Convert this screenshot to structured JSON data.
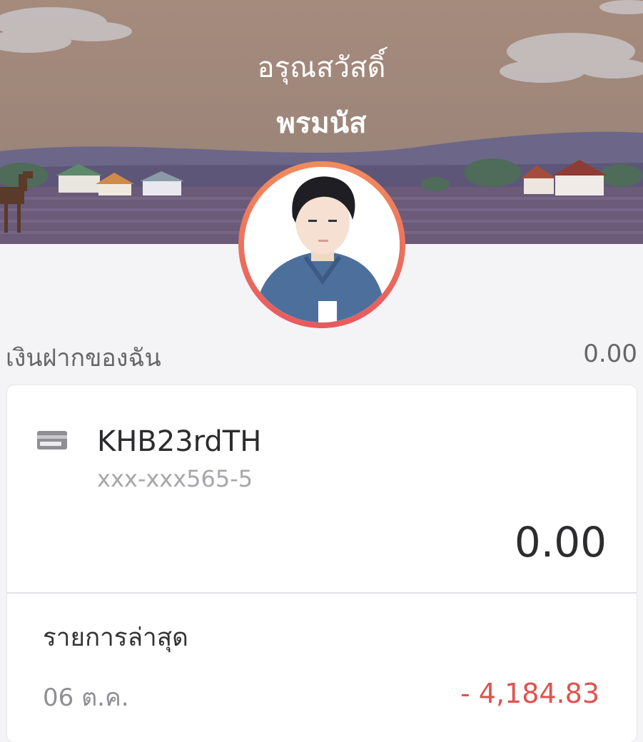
{
  "header": {
    "greeting": "อรุณสวัสดิ์",
    "username": "พรมนัส"
  },
  "deposit": {
    "label": "เงินฝากของฉัน",
    "total": "0.00"
  },
  "account": {
    "icon": "card-icon",
    "name": "KHB23rdTH",
    "number": "xxx-xxx565-5",
    "balance": "0.00"
  },
  "recent": {
    "title": "รายการล่าสุด",
    "transactions": [
      {
        "date": "06 ต.ค.",
        "amount": "- 4,184.83"
      }
    ]
  },
  "colors": {
    "accent_ring_top": "#f28b5c",
    "accent_ring_bottom": "#e7595e",
    "negative_amount": "#e0534f"
  }
}
